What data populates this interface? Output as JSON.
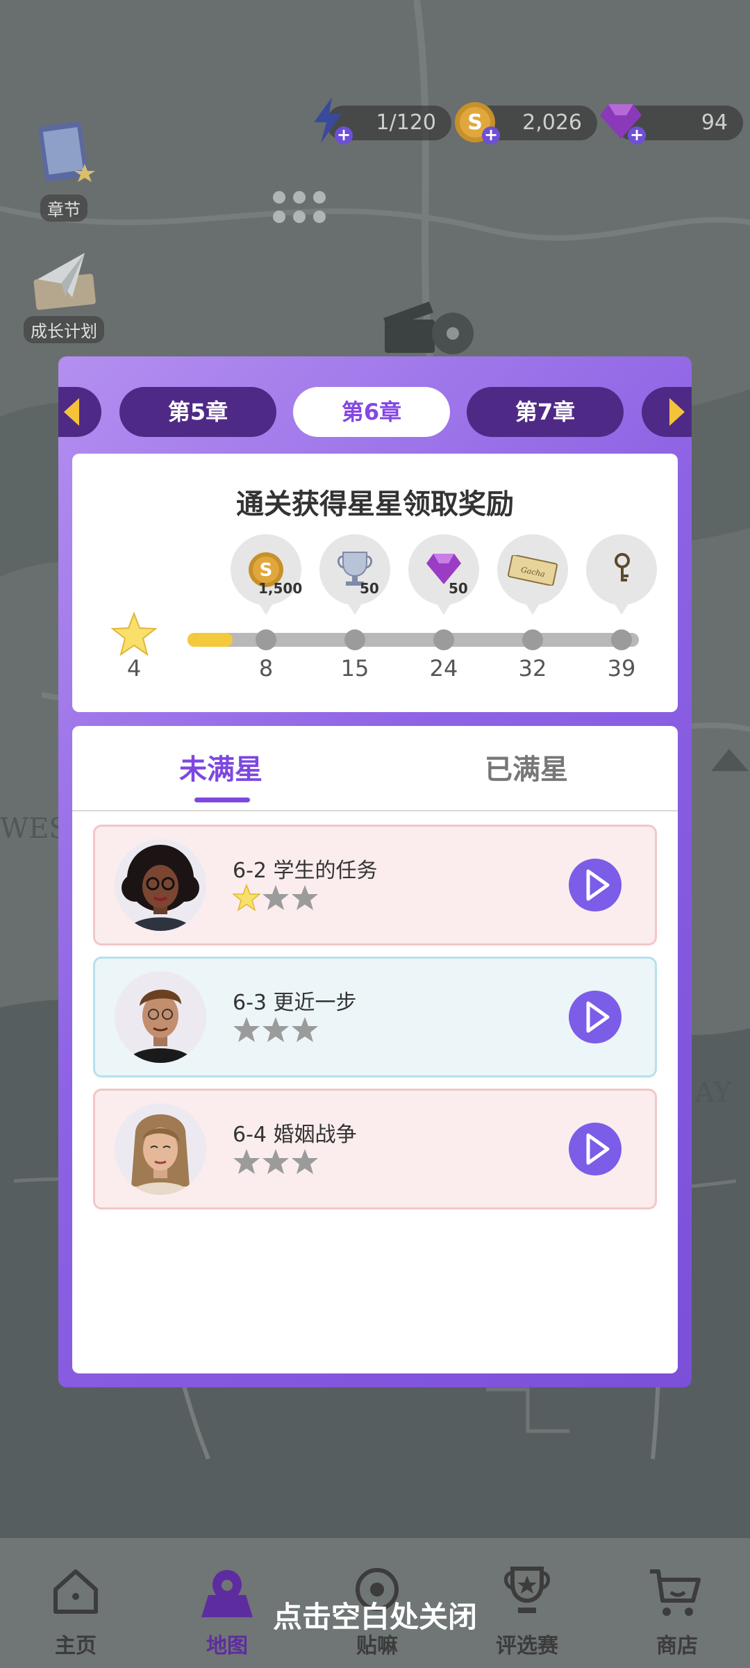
{
  "resources": {
    "energy": "1/120",
    "coins": "2,026",
    "gems": "94"
  },
  "side_menu": {
    "chapters_label": "章节",
    "growth_plan_label": "成长计划"
  },
  "map_labels": {
    "west": "WEST",
    "bay": "AY"
  },
  "chapters": {
    "prev": "第5章",
    "current": "第6章",
    "next": "第7章"
  },
  "rewards": {
    "title": "通关获得星星领取奖励",
    "current_stars": "4",
    "progress_fraction": 0.1,
    "milestones": [
      {
        "stars": "8",
        "icon": "coin-icon",
        "qty": "1,500"
      },
      {
        "stars": "15",
        "icon": "trophy-icon",
        "qty": "50"
      },
      {
        "stars": "24",
        "icon": "gem-icon",
        "qty": "50"
      },
      {
        "stars": "32",
        "icon": "ticket-icon",
        "qty": ""
      },
      {
        "stars": "39",
        "icon": "key-icon",
        "qty": ""
      }
    ],
    "ticket_text": "Gacha"
  },
  "tabs": {
    "not_full": "未满星",
    "full": "已满星"
  },
  "levels": [
    {
      "title": "6-2 学生的任务",
      "stars_earned": 1,
      "stars_total": 3,
      "style": "pink"
    },
    {
      "title": "6-3 更近一步",
      "stars_earned": 0,
      "stars_total": 3,
      "style": "blue"
    },
    {
      "title": "6-4 婚姻战争",
      "stars_earned": 0,
      "stars_total": 3,
      "style": "pink"
    }
  ],
  "bottom_nav": {
    "home": "主页",
    "map": "地图",
    "chat": "贴嘛",
    "contest": "评选赛",
    "shop": "商店"
  },
  "close_hint": "点击空白处关闭",
  "colors": {
    "accent": "#7d47e0",
    "star_gold": "#f4c93b",
    "star_empty": "#9b9b9b"
  }
}
